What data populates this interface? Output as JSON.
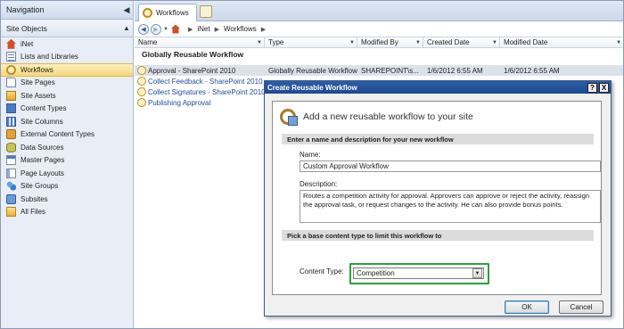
{
  "navigation": {
    "header": "Navigation",
    "section": "Site Objects",
    "items": [
      {
        "label": "iNet",
        "icon": "home-icon"
      },
      {
        "label": "Lists and Libraries",
        "icon": "list-icon"
      },
      {
        "label": "Workflows",
        "icon": "workflow-icon",
        "selected": true
      },
      {
        "label": "Site Pages",
        "icon": "page-icon"
      },
      {
        "label": "Site Assets",
        "icon": "assets-icon"
      },
      {
        "label": "Content Types",
        "icon": "content-types-icon"
      },
      {
        "label": "Site Columns",
        "icon": "site-columns-icon"
      },
      {
        "label": "External Content Types",
        "icon": "external-content-types-icon"
      },
      {
        "label": "Data Sources",
        "icon": "data-sources-icon"
      },
      {
        "label": "Master Pages",
        "icon": "master-pages-icon"
      },
      {
        "label": "Page Layouts",
        "icon": "page-layouts-icon"
      },
      {
        "label": "Site Groups",
        "icon": "site-groups-icon"
      },
      {
        "label": "Subsites",
        "icon": "subsites-icon"
      },
      {
        "label": "All Files",
        "icon": "folder-icon"
      }
    ]
  },
  "tabs": {
    "active_label": "Workflows"
  },
  "breadcrumb": {
    "items": [
      "iNet",
      "Workflows"
    ]
  },
  "columns": {
    "name": "Name",
    "type": "Type",
    "modified_by": "Modified By",
    "created_date": "Created Date",
    "modified_date": "Modified Date"
  },
  "group_title": "Globally Reusable Workflow",
  "rows": [
    {
      "name": "Approval - SharePoint 2010",
      "type": "Globally Reusable Workflow",
      "modified_by": "SHAREPOINT\\s...",
      "created": "1/6/2012 6:55 AM",
      "modified": "1/6/2012 6:55 AM"
    },
    {
      "name": "Collect Feedback - SharePoint 2010"
    },
    {
      "name": "Collect Signatures - SharePoint 2010"
    },
    {
      "name": "Publishing Approval"
    }
  ],
  "dialog": {
    "title": "Create Reusable Workflow",
    "help_button": "?",
    "close_button": "X",
    "heading": "Add a new reusable workflow to your site",
    "section1": "Enter a name and description for your new workflow",
    "name_label": "Name:",
    "name_value": "Custom Approval Workflow",
    "description_label": "Description:",
    "description_value": "Routes a competition activity for approval. Approvers can approve or reject the activity, reassign the approval task, or request changes to the activity. He can also provide bonus points.",
    "section2": "Pick a base content type to limit this workflow to",
    "content_type_label": "Content Type:",
    "content_type_value": "Competition",
    "ok_label": "OK",
    "cancel_label": "Cancel"
  },
  "colors": {
    "selected_nav": "#f6d97a",
    "dialog_title": "#1d4a8f",
    "highlight_box": "#2aa33a",
    "link": "#1c4d9b"
  }
}
